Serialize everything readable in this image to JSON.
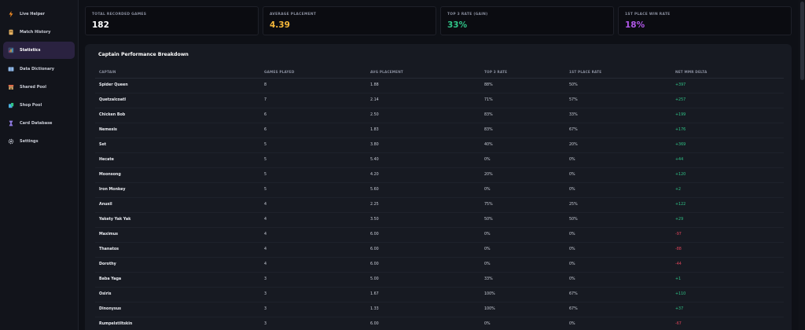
{
  "sidebar": {
    "items": [
      {
        "label": "Live Helper",
        "icon": "lightning-icon",
        "color": "#f08a24"
      },
      {
        "label": "Match History",
        "icon": "scroll-icon",
        "color": "#e8b463"
      },
      {
        "label": "Statistics",
        "icon": "bar-chart-icon",
        "color": "#9bb7e0",
        "active": true
      },
      {
        "label": "Data Dictionary",
        "icon": "book-icon",
        "color": "#8fb8e8"
      },
      {
        "label": "Shared Pool",
        "icon": "store-icon",
        "color": "#e06b4a"
      },
      {
        "label": "Shop Pool",
        "icon": "shopping-bag-icon",
        "color": "#4ab0e0"
      },
      {
        "label": "Card Database",
        "icon": "hourglass-icon",
        "color": "#8e7ae0"
      },
      {
        "label": "Settings",
        "icon": "gear-icon",
        "color": "#b8bcc6"
      }
    ]
  },
  "stats": [
    {
      "label": "TOTAL RECORDED GAMES",
      "value": "182",
      "color": "#ffffff"
    },
    {
      "label": "AVERAGE PLACEMENT",
      "value": "4.39",
      "color": "#f4b73a"
    },
    {
      "label": "TOP 3 RATE (GAIN)",
      "value": "33%",
      "color": "#2fc487"
    },
    {
      "label": "1ST PLACE WIN RATE",
      "value": "18%",
      "color": "#b158e8"
    }
  ],
  "table": {
    "title": "Captain Performance Breakdown",
    "columns": [
      "CAPTAIN",
      "GAMES PLAYED",
      "AVG PLACEMENT",
      "TOP 3 RATE",
      "1ST PLACE RATE",
      "NET MMR DELTA"
    ],
    "rows": [
      {
        "captain": "Spider Queen",
        "games": "8",
        "avg": "1.88",
        "top3": "88%",
        "first": "50%",
        "mmr": "+397"
      },
      {
        "captain": "Quetzalcoatl",
        "games": "7",
        "avg": "2.14",
        "top3": "71%",
        "first": "57%",
        "mmr": "+257"
      },
      {
        "captain": "Chicken Bob",
        "games": "6",
        "avg": "2.50",
        "top3": "83%",
        "first": "33%",
        "mmr": "+199"
      },
      {
        "captain": "Nemesis",
        "games": "6",
        "avg": "1.83",
        "top3": "83%",
        "first": "67%",
        "mmr": "+176"
      },
      {
        "captain": "Set",
        "games": "5",
        "avg": "3.80",
        "top3": "40%",
        "first": "20%",
        "mmr": "+369"
      },
      {
        "captain": "Hecate",
        "games": "5",
        "avg": "5.40",
        "top3": "0%",
        "first": "0%",
        "mmr": "+44"
      },
      {
        "captain": "Moonsong",
        "games": "5",
        "avg": "4.20",
        "top3": "20%",
        "first": "0%",
        "mmr": "+120"
      },
      {
        "captain": "Iron Monkey",
        "games": "5",
        "avg": "5.60",
        "top3": "0%",
        "first": "0%",
        "mmr": "+2"
      },
      {
        "captain": "Anusil",
        "games": "4",
        "avg": "2.25",
        "top3": "75%",
        "first": "25%",
        "mmr": "+122"
      },
      {
        "captain": "Yakety Yak Yak",
        "games": "4",
        "avg": "3.50",
        "top3": "50%",
        "first": "50%",
        "mmr": "+29"
      },
      {
        "captain": "Maximus",
        "games": "4",
        "avg": "6.00",
        "top3": "0%",
        "first": "0%",
        "mmr": "-97"
      },
      {
        "captain": "Thanatos",
        "games": "4",
        "avg": "6.00",
        "top3": "0%",
        "first": "0%",
        "mmr": "-88"
      },
      {
        "captain": "Dorothy",
        "games": "4",
        "avg": "6.00",
        "top3": "0%",
        "first": "0%",
        "mmr": "-44"
      },
      {
        "captain": "Baba Yaga",
        "games": "3",
        "avg": "5.00",
        "top3": "33%",
        "first": "0%",
        "mmr": "+1"
      },
      {
        "captain": "Osiris",
        "games": "3",
        "avg": "1.67",
        "top3": "100%",
        "first": "67%",
        "mmr": "+110"
      },
      {
        "captain": "Dinonysus",
        "games": "3",
        "avg": "1.33",
        "top3": "100%",
        "first": "67%",
        "mmr": "+37"
      },
      {
        "captain": "Rumpelstiltskin",
        "games": "3",
        "avg": "6.00",
        "top3": "0%",
        "first": "0%",
        "mmr": "-67"
      }
    ]
  }
}
